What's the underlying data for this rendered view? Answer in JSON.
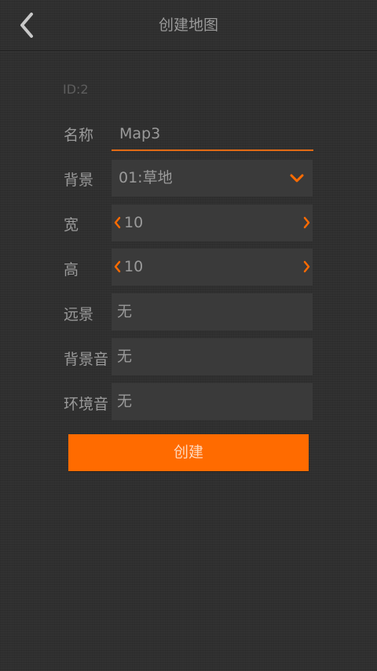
{
  "header": {
    "title": "创建地图",
    "back_icon": "chevron-left-icon"
  },
  "form": {
    "id_text": "ID:2",
    "name": {
      "label": "名称",
      "value": "Map3"
    },
    "background": {
      "label": "背景",
      "value": "01:草地",
      "icon": "chevron-down-icon"
    },
    "width": {
      "label": "宽",
      "value": "10",
      "decrease_icon": "chevron-left-icon",
      "increase_icon": "chevron-right-icon"
    },
    "height": {
      "label": "高",
      "value": "10",
      "decrease_icon": "chevron-left-icon",
      "increase_icon": "chevron-right-icon"
    },
    "distant_view": {
      "label": "远景",
      "value": "无"
    },
    "bgm": {
      "label": "背景音",
      "value": "无"
    },
    "ambient": {
      "label": "环境音",
      "value": "无"
    }
  },
  "actions": {
    "create_label": "创建"
  },
  "colors": {
    "accent": "#ff6b00",
    "underline": "#e26a14",
    "background": "#2f2f2f",
    "field": "#3a3a3a",
    "text": "#9a9a9a"
  }
}
